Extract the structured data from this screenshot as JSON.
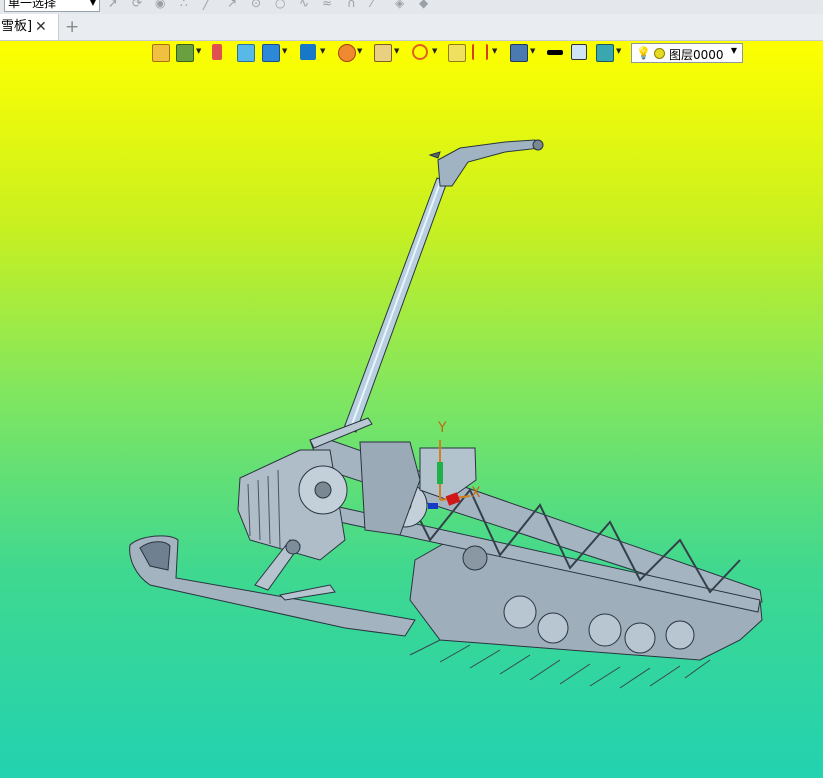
{
  "toolbar": {
    "selection_mode": "单一选择"
  },
  "tabs": [
    {
      "label": "雪板]",
      "close": "✕"
    }
  ],
  "tab_add": "+",
  "viewport": {
    "layer_name": "图层0000",
    "axis_x": "X",
    "axis_y": "Y",
    "colors": {
      "bg_top": "#ffff00",
      "bg_bottom": "#22d2b0",
      "model_fill": "#a9b9c4",
      "model_edge": "#2a3440"
    }
  },
  "icons": [
    "select-arrow-icon",
    "rotate-icon",
    "play-icon",
    "points-icon",
    "line-icon",
    "arrow-line-icon",
    "circle-icon",
    "arc-icon",
    "spline-icon",
    "wave-icon",
    "curve-icon",
    "diagonal-icon",
    "layer-icon",
    "stack-icon"
  ]
}
